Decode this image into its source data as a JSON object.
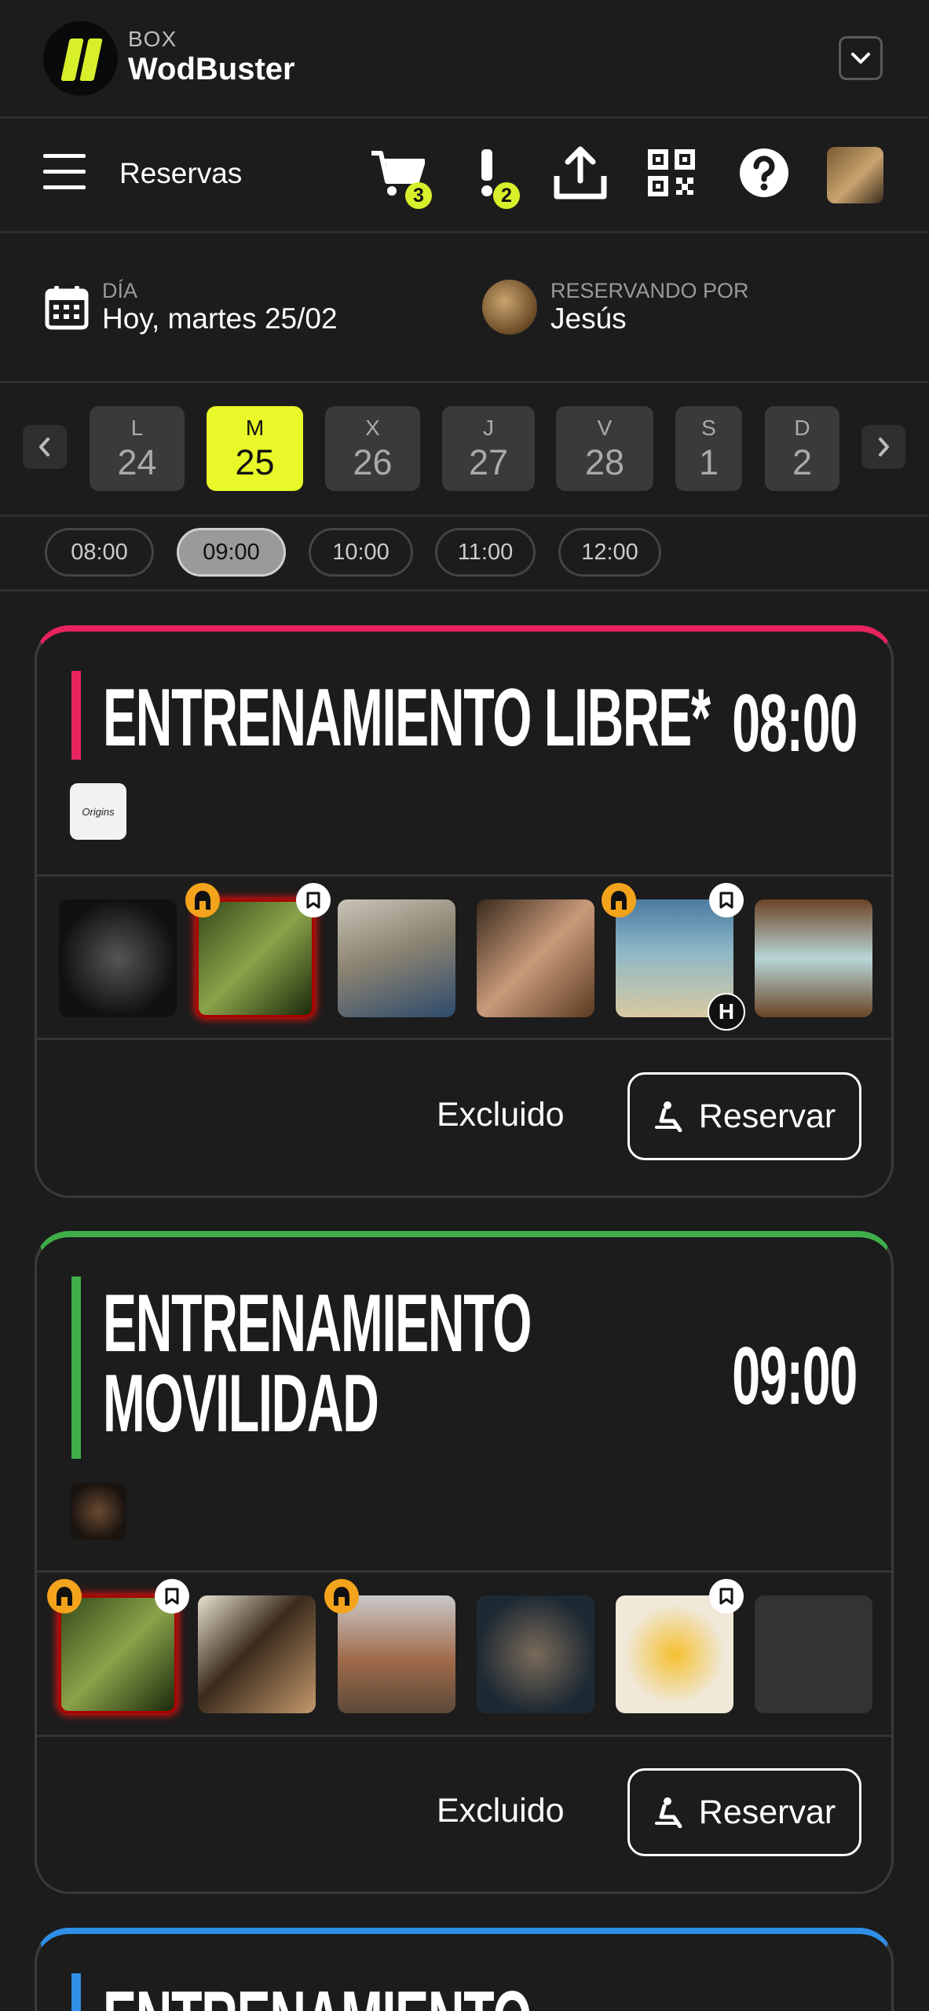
{
  "header": {
    "box_label": "BOX",
    "box_name": "WodBuster"
  },
  "toolbar": {
    "title": "Reservas",
    "cart_count": "3",
    "alerts_count": "2"
  },
  "day_info": {
    "dia_label": "DÍA",
    "dia_value": "Hoy, martes 25/02",
    "reservando_label": "RESERVANDO POR",
    "reservando_value": "Jesús"
  },
  "week": [
    {
      "letter": "L",
      "num": "24",
      "selected": false
    },
    {
      "letter": "M",
      "num": "25",
      "selected": true
    },
    {
      "letter": "X",
      "num": "26",
      "selected": false
    },
    {
      "letter": "J",
      "num": "27",
      "selected": false
    },
    {
      "letter": "V",
      "num": "28",
      "selected": false
    },
    {
      "letter": "S",
      "num": "1",
      "selected": false
    },
    {
      "letter": "D",
      "num": "2",
      "selected": false
    }
  ],
  "hours": [
    "08:00",
    "09:00",
    "10:00",
    "11:00",
    "12:00"
  ],
  "selected_hour": "09:00",
  "classes": [
    {
      "title_line1": "ENTRENAMIENTO LIBRE*",
      "title_line2": "",
      "time": "08:00",
      "accent": "#e8245f",
      "coach_logo_text": "Origins",
      "status": "Excluido",
      "button": "Reservar"
    },
    {
      "title_line1": "ENTRENAMIENTO",
      "title_line2": "MOVILIDAD",
      "time": "09:00",
      "accent": "#3fae4a",
      "status": "Excluido",
      "button": "Reservar"
    },
    {
      "title_line1": "ENTRENAMIENTO",
      "accent": "#2f8fe6"
    }
  ],
  "attendee_badges": {
    "h_badge": "H"
  },
  "colors": {
    "brand_yellow": "#e8f829",
    "bg": "#1c1c1c"
  }
}
